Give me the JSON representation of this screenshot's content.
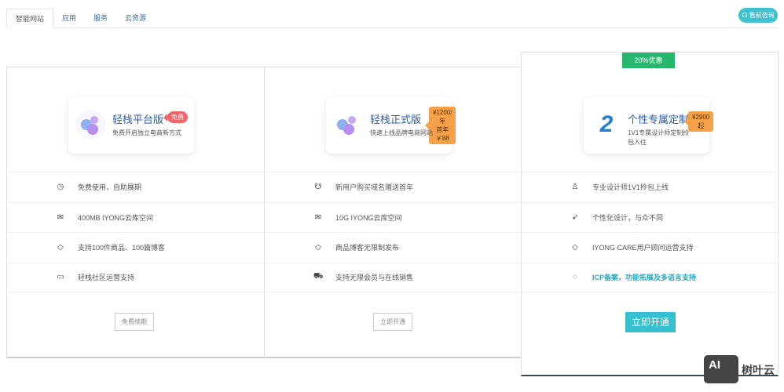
{
  "tabs": [
    "智能网站",
    "应用",
    "服务",
    "云资源"
  ],
  "consult_button": "售前咨询",
  "plans": [
    {
      "title": "轻栈平台版",
      "badge": "免费",
      "subtitle": "免费开启独立电商新方式",
      "features": [
        "免费使用，自助展期",
        "400MB IYONG云库空间",
        "支持100件商品、100篇博客",
        "轻栈社区运营支持"
      ],
      "icons": [
        "clock-icon",
        "inbox-icon",
        "tag-icon",
        "monitor-icon"
      ],
      "button": "免费续期"
    },
    {
      "title": "轻栈正式版",
      "badge_line1": "¥1200/年",
      "badge_line2": "首年￥88",
      "subtitle": "快速上线品牌电商网站",
      "features": [
        "新用户购买域名赠送首年",
        "10G IYONG云库空间",
        "商品博客无限制发布",
        "支持无限会员与在线销售"
      ],
      "icons": [
        "award-icon",
        "inbox-icon",
        "tag-icon",
        "cart-icon"
      ],
      "button": "立即开通"
    },
    {
      "promo": "20%优惠",
      "title": "个性专属定制",
      "badge": "¥2900起",
      "subtitle": "1V1专属设计师定制拎包入住",
      "features": [
        "专业设计师1V1拎包上线",
        "个性化设计，与众不同",
        "IYONG CARE用户顾问运营支持",
        "ICP备案，功能拓展及多语言支持"
      ],
      "icons": [
        "user-icon",
        "rocket-icon",
        "tag-icon",
        "chat-icon"
      ],
      "button": "立即开通"
    }
  ],
  "watermark": {
    "logo": "AI",
    "text": "树叶云"
  }
}
